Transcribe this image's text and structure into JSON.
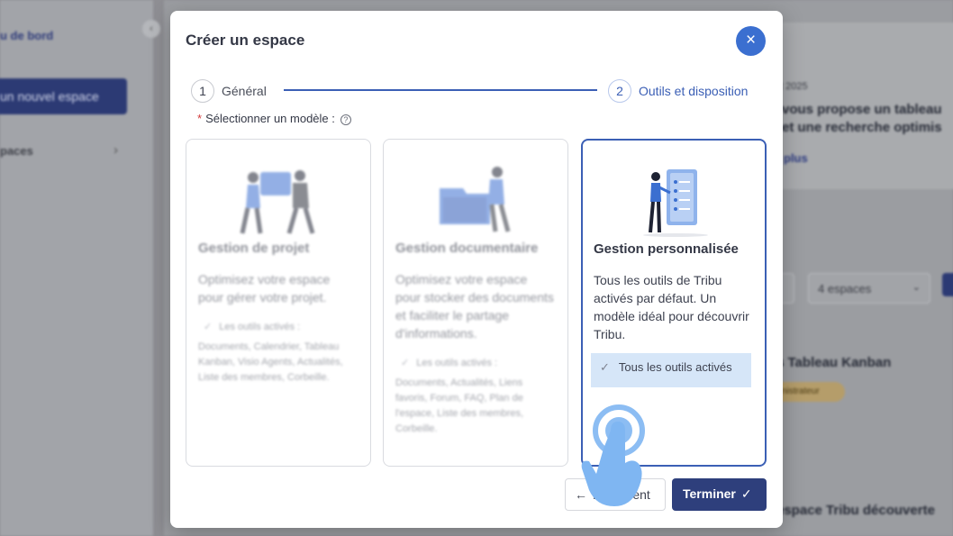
{
  "background": {
    "sidebar": {
      "dashboard_link": "u de bord",
      "new_space_button": "un nouvel espace",
      "spaces_item": "paces"
    },
    "news": {
      "date": "t 2025",
      "headline_line1": "vous propose un tableau",
      "headline_line2": "et une recherche optimis",
      "more_link": "plus"
    },
    "filter_select": "4 espaces",
    "space_kanban": "s Tableau Kanban",
    "space_kanban_role": "nistrateur",
    "space_tribu": "espace Tribu découverte"
  },
  "modal": {
    "title": "Créer un espace",
    "close_icon": "×",
    "steps": [
      {
        "number": "1",
        "label": "Général"
      },
      {
        "number": "2",
        "label": "Outils et disposition"
      }
    ],
    "model_label": "Sélectionner un modèle :",
    "model_required_mark": "*",
    "help_icon": "?",
    "templates": [
      {
        "title": "Gestion de projet",
        "description": "Optimisez votre espace pour gérer votre projet.",
        "tools_heading": "Les outils activés :",
        "tools_list": "Documents, Calendrier, Tableau Kanban, Visio Agents, Actualités, Liste des membres, Corbeille."
      },
      {
        "title": "Gestion documentaire",
        "description": "Optimisez votre espace pour stocker des documents et faciliter le partage d'informations.",
        "tools_heading": "Les outils activés :",
        "tools_list": "Documents, Actualités, Liens favoris, Forum, FAQ, Plan de l'espace, Liste des membres, Corbeille."
      },
      {
        "title": "Gestion personnalisée",
        "description": "Tous les outils de Tribu activés par défaut. Un modèle idéal pour découvrir Tribu.",
        "tools_heading": "Tous les outils activés",
        "selected": true
      }
    ],
    "previous_button": "Précédent",
    "finish_button": "Terminer",
    "check_glyph": "✓",
    "arrow_left_glyph": "←"
  },
  "colors": {
    "primary": "#3b5fb5",
    "primary_dark": "#2e3f7c",
    "close": "#3b6fd0",
    "highlight": "#d6e6f8"
  }
}
